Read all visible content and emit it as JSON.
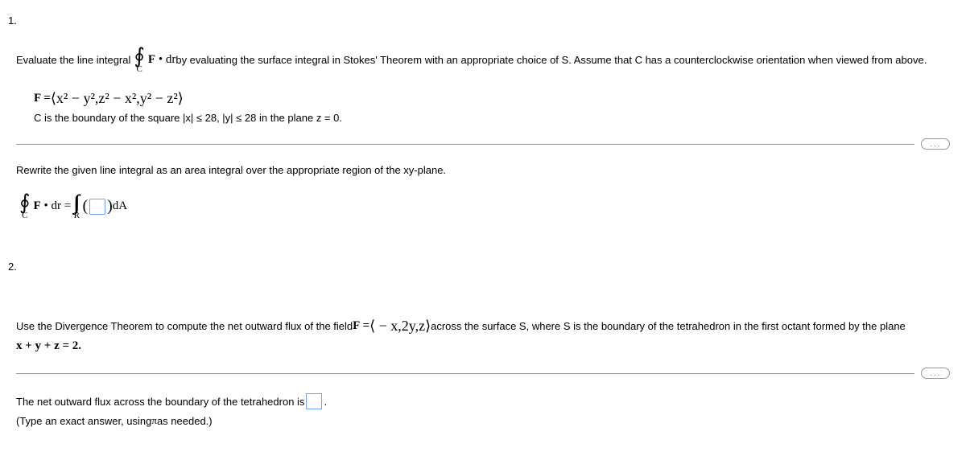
{
  "q1": {
    "number": "1.",
    "line1_a": "Evaluate the line integral",
    "int_top1": "",
    "int_sub1": "C",
    "bF1": "F",
    "dot_dr1": " • dr",
    "line1_b": " by evaluating the surface integral in Stokes' Theorem with an appropriate choice of S. Assume that C has a counterclockwise orientation when viewed from above.",
    "Feq": "F = ",
    "Fvec": "⟨x² − y²,z² − x²,y² − z²⟩",
    "Cdesc_a": "C is the boundary of the square |x| ≤ 28, |y| ≤ 28 in the plane z = 0.",
    "rewrite": "Rewrite the given line integral as an area integral over the appropriate region of the xy-plane.",
    "int_sub2": "C",
    "bF2": "F",
    "dot_dr2": " • dr = ",
    "dbl_sub": "R",
    "paren_open": "(",
    "paren_close": ")",
    "dA": " dA"
  },
  "q2": {
    "number": "2.",
    "line1_a": "Use the Divergence Theorem to compute the net outward flux of the field ",
    "Feq": "F = ",
    "Fvec": "⟨ − x,2y,z⟩",
    "line1_b": "  across the surface S, where S is the boundary of the tetrahedron in the first octant formed by the plane",
    "plane": "x + y + z = 2.",
    "ans1": "The net outward flux across the boundary of the tetrahedron is ",
    "period": ".",
    "hint_a": "(Type an exact answer, using ",
    "pi": "π",
    "hint_b": " as needed.)"
  },
  "dots": "..."
}
